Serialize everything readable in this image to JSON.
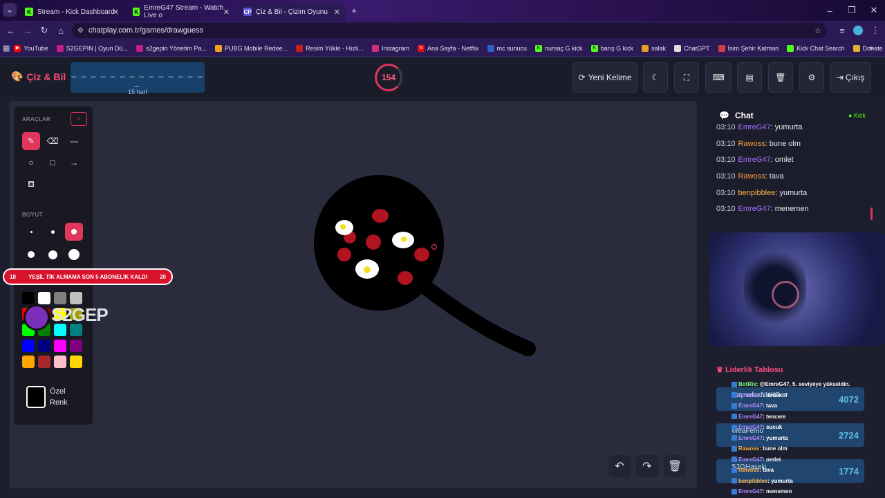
{
  "browser": {
    "tabs": [
      {
        "title": "Stream - Kick Dashboard",
        "icon": "kick-icon"
      },
      {
        "title": "EmreG47 Stream - Watch Live o",
        "icon": "kick-icon"
      },
      {
        "title": "Çiz & Bil - Çizim Oyunu",
        "icon": "chatplay-icon"
      }
    ],
    "url": "chatplay.com.tr/games/drawguess",
    "bookmarks": [
      "YouTube",
      "S2GEPIN | Oyun Dü...",
      "s2gepin Yönetim Pa...",
      "PUBG Mobile Redee...",
      "Resim Yükle - Hızlı...",
      "Instagram",
      "Ana Sayfa - Netflix",
      "mc sunucu",
      "nursaç G kick",
      "barış G kick",
      "salak",
      "ChatGPT",
      "İsim Şehir Katman",
      "Kick Chat Search",
      "Donate ByNoGame..."
    ]
  },
  "header": {
    "logo": "Çiz & Bil",
    "word_mask": "_ _ _ _ _ _ _ _ _ _ _ _ _ _ _",
    "word_length": "15 harf",
    "timer": "154",
    "timer_progress": 0.8,
    "new_word": "Yeni Kelime",
    "logout": "Çıkış"
  },
  "tools": {
    "section_tools": "ARAÇLAR",
    "section_size": "BOYUT",
    "custom_color_line1": "Özel",
    "custom_color_line2": "Renk",
    "active_tool": "brush",
    "active_size": 3,
    "colors": [
      "#000000",
      "#ffffff",
      "#808080",
      "#c0c0c0",
      "#ff0000",
      "#8b0000",
      "#ffff00",
      "#a0a000",
      "#00ff00",
      "#008000",
      "#00ffff",
      "#008080",
      "#0000ff",
      "#000080",
      "#ff00ff",
      "#800080",
      "#ffa500",
      "#a52a2a",
      "#ffc0cb",
      "#ffd700"
    ]
  },
  "overlay": {
    "banner_left": "18",
    "banner_text": "YEŞİL TİK ALMAMA SON 5 ABONELİK KALDI",
    "banner_right": "20",
    "logo_text": "S2GEP"
  },
  "chat": {
    "title": "Chat",
    "badge": "Kick",
    "messages": [
      {
        "time": "03:10",
        "user": "EmreG47",
        "color": "#a070ff",
        "text": "yumurta"
      },
      {
        "time": "03:10",
        "user": "Rawoss",
        "color": "#ff9a3c",
        "text": "bune olm"
      },
      {
        "time": "03:10",
        "user": "EmreG47",
        "color": "#a070ff",
        "text": "omlet"
      },
      {
        "time": "03:10",
        "user": "Rawoss",
        "color": "#ff9a3c",
        "text": "tava"
      },
      {
        "time": "03:10",
        "user": "benpibblee",
        "color": "#ffb347",
        "text": "yumurta"
      },
      {
        "time": "03:10",
        "user": "EmreG47",
        "color": "#a070ff",
        "text": "menemen"
      }
    ]
  },
  "leaderboard": {
    "title": "Liderlik Tablosu",
    "rows": [
      {
        "rank": "1",
        "name": "RaynefoxNUKS",
        "score": "4072"
      },
      {
        "rank": "2",
        "name": "WeaFemo",
        "score": "2724"
      },
      {
        "rank": "3",
        "name": "S2GHaseki",
        "score": "1774"
      }
    ]
  },
  "overlay_chat": [
    {
      "user": "BotRix",
      "color": "#7cff7c",
      "text": "@EmreG47, 5. seviyeye yükseldin."
    },
    {
      "user": "EmreG47",
      "color": "#b388ff",
      "text": "dedektif"
    },
    {
      "user": "EmreG47",
      "color": "#b388ff",
      "text": "tava"
    },
    {
      "user": "EmreG47",
      "color": "#b388ff",
      "text": "tencere"
    },
    {
      "user": "EmreG47",
      "color": "#b388ff",
      "text": "sucuk"
    },
    {
      "user": "EmreG47",
      "color": "#b388ff",
      "text": "yumurta"
    },
    {
      "user": "Rawoss",
      "color": "#ffb347",
      "text": "bune olm"
    },
    {
      "user": "EmreG47",
      "color": "#b388ff",
      "text": "omlet"
    },
    {
      "user": "Rawoss",
      "color": "#ffb347",
      "text": "tava"
    },
    {
      "user": "benpibblee",
      "color": "#ffb347",
      "text": "yumurta"
    },
    {
      "user": "EmreG47",
      "color": "#b388ff",
      "text": "menemen"
    }
  ]
}
